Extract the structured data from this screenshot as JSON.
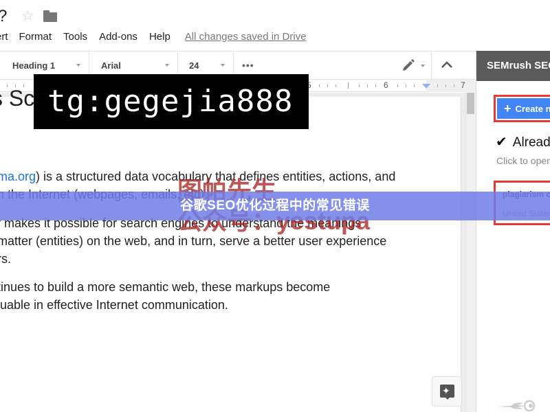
{
  "header": {
    "title_fragment": "?",
    "star_icon": "star-outline-icon",
    "folder_icon": "folder-icon"
  },
  "menu": {
    "items": [
      "ert",
      "Format",
      "Tools",
      "Add-ons",
      "Help"
    ],
    "saved_status": "All changes saved in Drive"
  },
  "toolbar": {
    "paragraph_style": "Heading 1",
    "font": "Arial",
    "font_size": "24",
    "more_label": "•••",
    "pen_icon": "editing-mode-pencil-icon",
    "collapse_icon": "chevron-up-icon"
  },
  "ruler": {
    "numbers": [
      "5",
      "6",
      "7"
    ]
  },
  "document": {
    "heading": "s Schema?",
    "paragraphs": [
      {
        "link": "ema.org",
        "lines": [
          ") is a structured data vocabulary that defines entities, actions, and",
          "on the Internet (webpages, emails, etc)."
        ]
      },
      {
        "lines": [
          "ry makes it possible for search engines to understand the meanings",
          "t matter (entities) on the web, and in turn, serve a better user experience",
          "ers."
        ]
      },
      {
        "lines": [
          "ntinues to build a more semantic web, these markups become",
          "aluable in effective Internet communication."
        ]
      }
    ],
    "explore_icon": "explore-icon"
  },
  "watermark": {
    "line1": "图帕先生",
    "line2": "公众号：yestupa"
  },
  "overlay_label": {
    "text": "tg:gegejia888"
  },
  "side_panel": {
    "title": "SEMrush SEO Writing Assistant",
    "create_button": "Create new template",
    "already_label": "Already",
    "click_to_open": "Click to open",
    "card_title": "plagiarism checker",
    "card_subtitle": "United States"
  },
  "banner": {
    "text": "谷歌SEO优化过程中的常见错误"
  },
  "colors": {
    "accent_blue": "#4285f4",
    "highlight_red": "#e53935",
    "panel_header": "#5a5a5a",
    "banner": "#6e7de6",
    "link": "#1a73e8"
  }
}
